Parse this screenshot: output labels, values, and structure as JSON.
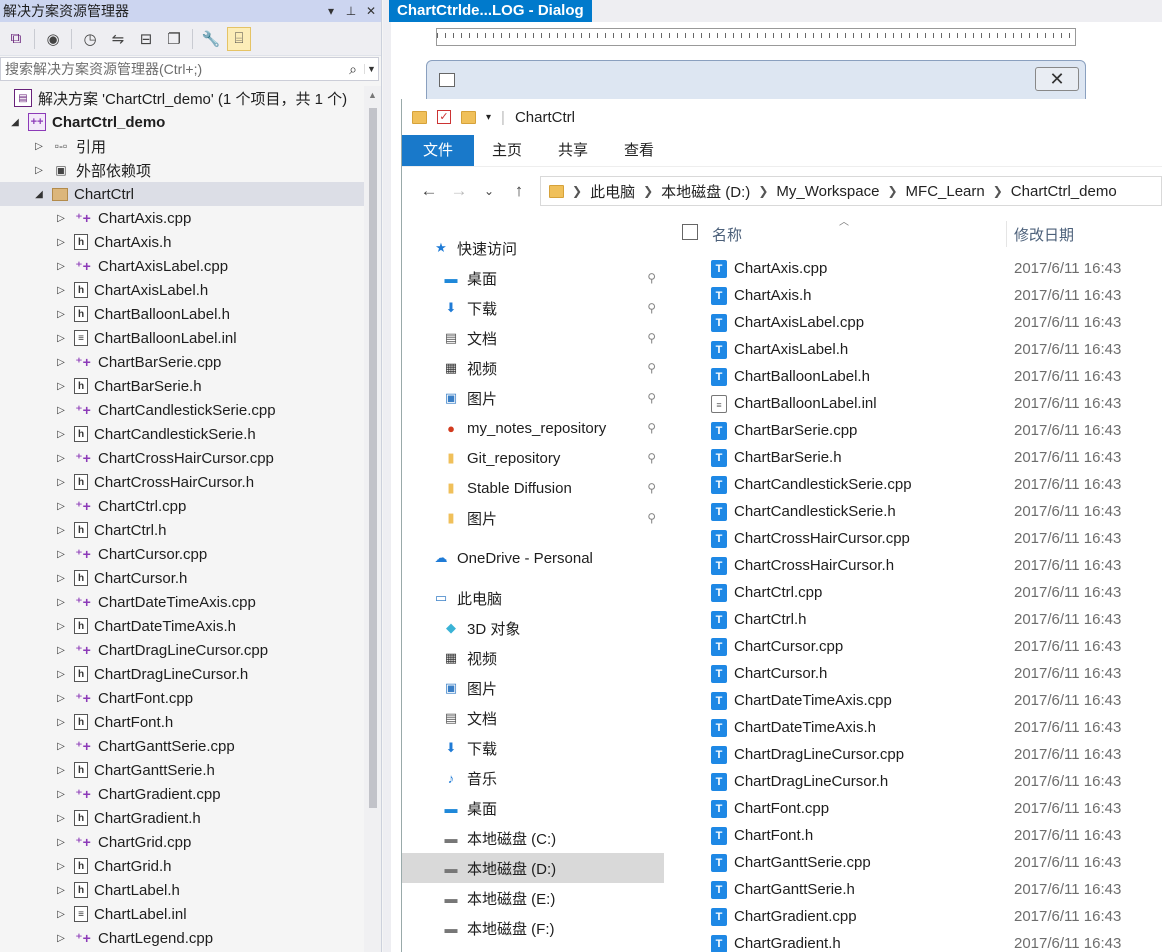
{
  "solution_explorer": {
    "title": "解决方案资源管理器",
    "title_controls": [
      "▾",
      "⊥",
      "✕"
    ],
    "search_placeholder": "搜索解决方案资源管理器(Ctrl+;)",
    "solution_label": "解决方案 'ChartCtrl_demo' (1 个项目，共 1 个)",
    "project_label": "ChartCtrl_demo",
    "references_label": "引用",
    "external_deps_label": "外部依赖项",
    "folder_label": "ChartCtrl",
    "files": [
      {
        "name": "ChartAxis.cpp",
        "type": "cpp"
      },
      {
        "name": "ChartAxis.h",
        "type": "h"
      },
      {
        "name": "ChartAxisLabel.cpp",
        "type": "cpp"
      },
      {
        "name": "ChartAxisLabel.h",
        "type": "h"
      },
      {
        "name": "ChartBalloonLabel.h",
        "type": "h"
      },
      {
        "name": "ChartBalloonLabel.inl",
        "type": "inl"
      },
      {
        "name": "ChartBarSerie.cpp",
        "type": "cpp"
      },
      {
        "name": "ChartBarSerie.h",
        "type": "h"
      },
      {
        "name": "ChartCandlestickSerie.cpp",
        "type": "cpp"
      },
      {
        "name": "ChartCandlestickSerie.h",
        "type": "h"
      },
      {
        "name": "ChartCrossHairCursor.cpp",
        "type": "cpp"
      },
      {
        "name": "ChartCrossHairCursor.h",
        "type": "h"
      },
      {
        "name": "ChartCtrl.cpp",
        "type": "cpp"
      },
      {
        "name": "ChartCtrl.h",
        "type": "h"
      },
      {
        "name": "ChartCursor.cpp",
        "type": "cpp"
      },
      {
        "name": "ChartCursor.h",
        "type": "h"
      },
      {
        "name": "ChartDateTimeAxis.cpp",
        "type": "cpp"
      },
      {
        "name": "ChartDateTimeAxis.h",
        "type": "h"
      },
      {
        "name": "ChartDragLineCursor.cpp",
        "type": "cpp"
      },
      {
        "name": "ChartDragLineCursor.h",
        "type": "h"
      },
      {
        "name": "ChartFont.cpp",
        "type": "cpp"
      },
      {
        "name": "ChartFont.h",
        "type": "h"
      },
      {
        "name": "ChartGanttSerie.cpp",
        "type": "cpp"
      },
      {
        "name": "ChartGanttSerie.h",
        "type": "h"
      },
      {
        "name": "ChartGradient.cpp",
        "type": "cpp"
      },
      {
        "name": "ChartGradient.h",
        "type": "h"
      },
      {
        "name": "ChartGrid.cpp",
        "type": "cpp"
      },
      {
        "name": "ChartGrid.h",
        "type": "h"
      },
      {
        "name": "ChartLabel.h",
        "type": "h"
      },
      {
        "name": "ChartLabel.inl",
        "type": "inl"
      },
      {
        "name": "ChartLegend.cpp",
        "type": "cpp"
      }
    ]
  },
  "editor": {
    "doc_tab": "ChartCtrlde...LOG - Dialog",
    "dialog_close_glyph": "✕"
  },
  "file_explorer": {
    "title": "ChartCtrl",
    "ribbon_tabs": [
      "文件",
      "主页",
      "共享",
      "查看"
    ],
    "breadcrumb": [
      "此电脑",
      "本地磁盘 (D:)",
      "My_Workspace",
      "MFC_Learn",
      "ChartCtrl_demo"
    ],
    "columns": {
      "name": "名称",
      "date": "修改日期"
    },
    "nav": [
      {
        "label": "快速访问",
        "icon": "★",
        "color": "#1f7bd6",
        "pinned": false,
        "indent": 0
      },
      {
        "label": "桌面",
        "icon": "▬",
        "color": "#1f88d9",
        "pinned": true,
        "indent": 1
      },
      {
        "label": "下载",
        "icon": "⬇",
        "color": "#1f7bd6",
        "pinned": true,
        "indent": 1
      },
      {
        "label": "文档",
        "icon": "▤",
        "color": "#555",
        "pinned": true,
        "indent": 1
      },
      {
        "label": "视频",
        "icon": "▦",
        "color": "#333",
        "pinned": true,
        "indent": 1
      },
      {
        "label": "图片",
        "icon": "▣",
        "color": "#3a7fc6",
        "pinned": true,
        "indent": 1
      },
      {
        "label": "my_notes_repository",
        "icon": "●",
        "color": "#d23b1e",
        "pinned": true,
        "indent": 1
      },
      {
        "label": "Git_repository",
        "icon": "▮",
        "color": "#f0c05a",
        "pinned": true,
        "indent": 1
      },
      {
        "label": "Stable Diffusion",
        "icon": "▮",
        "color": "#f0c05a",
        "pinned": true,
        "indent": 1
      },
      {
        "label": "图片",
        "icon": "▮",
        "color": "#f0c05a",
        "pinned": true,
        "indent": 1
      },
      {
        "label": "OneDrive - Personal",
        "icon": "☁",
        "color": "#1f7bd6",
        "pinned": false,
        "indent": 0,
        "gap": true
      },
      {
        "label": "此电脑",
        "icon": "▭",
        "color": "#3a7fc6",
        "pinned": false,
        "indent": 0,
        "gap": true
      },
      {
        "label": "3D 对象",
        "icon": "◆",
        "color": "#3ab3d6",
        "pinned": false,
        "indent": 1
      },
      {
        "label": "视频",
        "icon": "▦",
        "color": "#333",
        "pinned": false,
        "indent": 1
      },
      {
        "label": "图片",
        "icon": "▣",
        "color": "#3a7fc6",
        "pinned": false,
        "indent": 1
      },
      {
        "label": "文档",
        "icon": "▤",
        "color": "#555",
        "pinned": false,
        "indent": 1
      },
      {
        "label": "下载",
        "icon": "⬇",
        "color": "#1f7bd6",
        "pinned": false,
        "indent": 1
      },
      {
        "label": "音乐",
        "icon": "♪",
        "color": "#1f7bd6",
        "pinned": false,
        "indent": 1
      },
      {
        "label": "桌面",
        "icon": "▬",
        "color": "#1f88d9",
        "pinned": false,
        "indent": 1
      },
      {
        "label": "本地磁盘 (C:)",
        "icon": "▬",
        "color": "#777",
        "pinned": false,
        "indent": 1
      },
      {
        "label": "本地磁盘 (D:)",
        "icon": "▬",
        "color": "#777",
        "pinned": false,
        "indent": 1,
        "selected": true
      },
      {
        "label": "本地磁盘 (E:)",
        "icon": "▬",
        "color": "#777",
        "pinned": false,
        "indent": 1
      },
      {
        "label": "本地磁盘 (F:)",
        "icon": "▬",
        "color": "#777",
        "pinned": false,
        "indent": 1
      }
    ],
    "files": [
      {
        "name": "ChartAxis.cpp",
        "date": "2017/6/11 16:43",
        "kind": "src"
      },
      {
        "name": "ChartAxis.h",
        "date": "2017/6/11 16:43",
        "kind": "src"
      },
      {
        "name": "ChartAxisLabel.cpp",
        "date": "2017/6/11 16:43",
        "kind": "src"
      },
      {
        "name": "ChartAxisLabel.h",
        "date": "2017/6/11 16:43",
        "kind": "src"
      },
      {
        "name": "ChartBalloonLabel.h",
        "date": "2017/6/11 16:43",
        "kind": "src"
      },
      {
        "name": "ChartBalloonLabel.inl",
        "date": "2017/6/11 16:43",
        "kind": "txt"
      },
      {
        "name": "ChartBarSerie.cpp",
        "date": "2017/6/11 16:43",
        "kind": "src"
      },
      {
        "name": "ChartBarSerie.h",
        "date": "2017/6/11 16:43",
        "kind": "src"
      },
      {
        "name": "ChartCandlestickSerie.cpp",
        "date": "2017/6/11 16:43",
        "kind": "src"
      },
      {
        "name": "ChartCandlestickSerie.h",
        "date": "2017/6/11 16:43",
        "kind": "src"
      },
      {
        "name": "ChartCrossHairCursor.cpp",
        "date": "2017/6/11 16:43",
        "kind": "src"
      },
      {
        "name": "ChartCrossHairCursor.h",
        "date": "2017/6/11 16:43",
        "kind": "src"
      },
      {
        "name": "ChartCtrl.cpp",
        "date": "2017/6/11 16:43",
        "kind": "src"
      },
      {
        "name": "ChartCtrl.h",
        "date": "2017/6/11 16:43",
        "kind": "src"
      },
      {
        "name": "ChartCursor.cpp",
        "date": "2017/6/11 16:43",
        "kind": "src"
      },
      {
        "name": "ChartCursor.h",
        "date": "2017/6/11 16:43",
        "kind": "src"
      },
      {
        "name": "ChartDateTimeAxis.cpp",
        "date": "2017/6/11 16:43",
        "kind": "src"
      },
      {
        "name": "ChartDateTimeAxis.h",
        "date": "2017/6/11 16:43",
        "kind": "src"
      },
      {
        "name": "ChartDragLineCursor.cpp",
        "date": "2017/6/11 16:43",
        "kind": "src"
      },
      {
        "name": "ChartDragLineCursor.h",
        "date": "2017/6/11 16:43",
        "kind": "src"
      },
      {
        "name": "ChartFont.cpp",
        "date": "2017/6/11 16:43",
        "kind": "src"
      },
      {
        "name": "ChartFont.h",
        "date": "2017/6/11 16:43",
        "kind": "src"
      },
      {
        "name": "ChartGanttSerie.cpp",
        "date": "2017/6/11 16:43",
        "kind": "src"
      },
      {
        "name": "ChartGanttSerie.h",
        "date": "2017/6/11 16:43",
        "kind": "src"
      },
      {
        "name": "ChartGradient.cpp",
        "date": "2017/6/11 16:43",
        "kind": "src"
      },
      {
        "name": "ChartGradient.h",
        "date": "2017/6/11 16:43",
        "kind": "src"
      }
    ]
  }
}
